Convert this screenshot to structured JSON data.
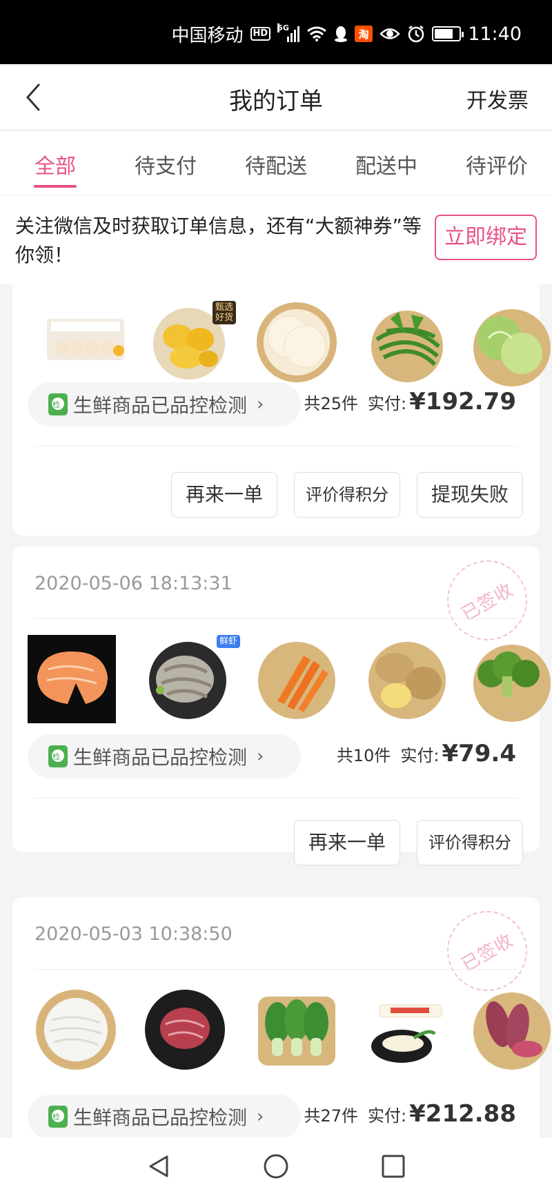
{
  "status": {
    "carrier": "中国移动",
    "network": "5G",
    "time": "11:40",
    "hd": "HD",
    "taobao": "淘",
    "battery_level": 0.75
  },
  "nav": {
    "title": "我的订单",
    "right": "开发票"
  },
  "tabs": [
    {
      "label": "全部",
      "active": true
    },
    {
      "label": "待支付",
      "active": false
    },
    {
      "label": "待配送",
      "active": false
    },
    {
      "label": "配送中",
      "active": false
    },
    {
      "label": "待评价",
      "active": false
    }
  ],
  "banner": {
    "text": "关注微信及时获取订单信息，还有“大额神券”等你领！",
    "button": "立即绑定"
  },
  "orders": [
    {
      "date": "",
      "thumbs": [
        "eggs",
        "durian",
        "dumpling-wrappers",
        "green-beans",
        "cabbage"
      ],
      "thumb_tag": "甄选好货",
      "qc": "生鲜商品已品控检测",
      "count": "共25件",
      "paid_label": "实付:",
      "amount": "¥192.79",
      "buttons": [
        "再来一单",
        "评价得积分",
        "提现失败"
      ]
    },
    {
      "date": "2020-05-06 18:13:31",
      "stamp": "已签收",
      "thumbs": [
        "salmon",
        "shrimp",
        "carrots",
        "potatoes",
        "broccoli"
      ],
      "thumb_tag": "鲜虾",
      "qc": "生鲜商品已品控检测",
      "count": "共10件",
      "paid_label": "实付:",
      "amount": "¥79.4",
      "buttons": [
        "再来一单",
        "评价得积分"
      ]
    },
    {
      "date": "2020-05-03 10:38:50",
      "stamp": "已签收",
      "thumbs": [
        "rice-noodles",
        "beef-slices",
        "bok-choy",
        "tofu",
        "sweet-potatoes"
      ],
      "thumb_tag": "",
      "qc": "生鲜商品已品控检测",
      "count": "共27件",
      "paid_label": "实付:",
      "amount": "¥212.88",
      "buttons": []
    }
  ]
}
